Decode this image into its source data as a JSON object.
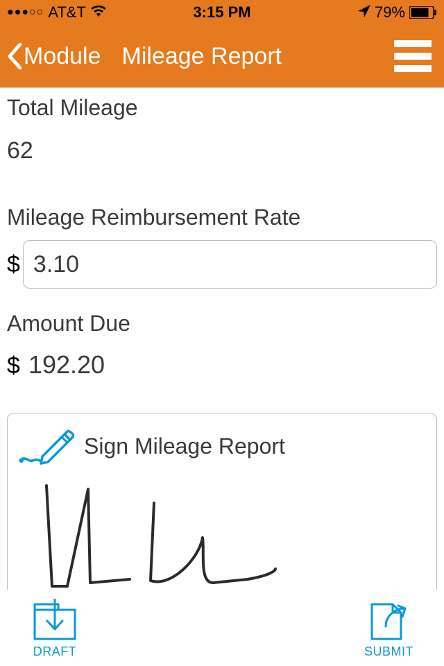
{
  "status": {
    "carrier": "AT&T",
    "time": "3:15 PM",
    "battery": "79%"
  },
  "nav": {
    "back": "Module",
    "title": "Mileage Report"
  },
  "labels": {
    "total_mileage": "Total Mileage",
    "rate": "Mileage Reimbursement Rate",
    "amount_due": "Amount Due",
    "sign": "Sign Mileage Report",
    "currency": "$"
  },
  "values": {
    "total_mileage": "62",
    "rate": "3.10",
    "amount_due": "192.20"
  },
  "buttons": {
    "draft": "DRAFT",
    "submit": "SUBMIT"
  }
}
